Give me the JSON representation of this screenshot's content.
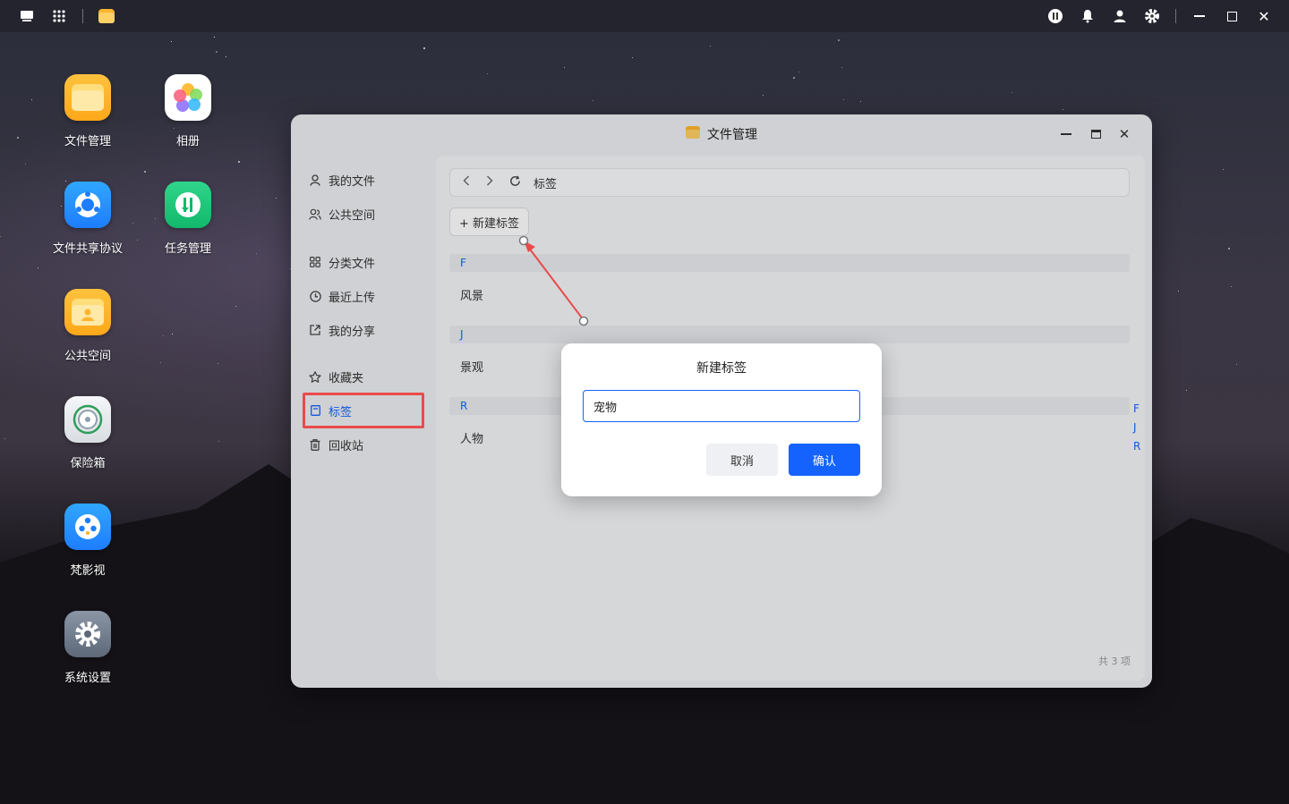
{
  "colors": {
    "accent": "#1463ff",
    "annotation_red": "#e84b4b"
  },
  "topbar": {
    "left_icons": [
      "desktop-icon",
      "apps-grid-icon",
      "file-manager-icon"
    ],
    "right_icons": [
      "dashboard-icon",
      "bell-icon",
      "user-icon",
      "gear-icon",
      "minimize-icon",
      "maximize-icon",
      "close-icon"
    ]
  },
  "desktop": {
    "icons": [
      {
        "label": "文件管理",
        "icon": "folder-icon"
      },
      {
        "label": "相册",
        "icon": "photos-icon"
      },
      {
        "label": "文件共享协议",
        "icon": "share-protocol-icon"
      },
      {
        "label": "任务管理",
        "icon": "task-icon"
      },
      {
        "label": "公共空间",
        "icon": "public-folder-icon"
      },
      {
        "label": "保险箱",
        "icon": "safe-icon"
      },
      {
        "label": "梵影视",
        "icon": "video-icon"
      },
      {
        "label": "系统设置",
        "icon": "settings-icon"
      }
    ]
  },
  "window": {
    "title": "文件管理",
    "sidebar": [
      {
        "label": "我的文件",
        "icon": "user-icon"
      },
      {
        "label": "公共空间",
        "icon": "users-icon"
      },
      {
        "label": "分类文件",
        "icon": "grid-icon"
      },
      {
        "label": "最近上传",
        "icon": "clock-icon"
      },
      {
        "label": "我的分享",
        "icon": "share-icon"
      },
      {
        "label": "收藏夹",
        "icon": "star-icon"
      },
      {
        "label": "标签",
        "icon": "tag-icon",
        "active": true
      },
      {
        "label": "回收站",
        "icon": "trash-icon"
      }
    ],
    "breadcrumb": "标签",
    "new_tag_label": "+ 新建标签",
    "groups": [
      {
        "letter": "F",
        "tags": [
          "风景"
        ]
      },
      {
        "letter": "J",
        "tags": [
          "景观"
        ]
      },
      {
        "letter": "R",
        "tags": [
          "人物"
        ]
      }
    ],
    "index_letters": [
      "F",
      "J",
      "R"
    ],
    "total": "共 3 项"
  },
  "dialog": {
    "title": "新建标签",
    "input_value": "宠物",
    "cancel_label": "取消",
    "confirm_label": "确认"
  }
}
